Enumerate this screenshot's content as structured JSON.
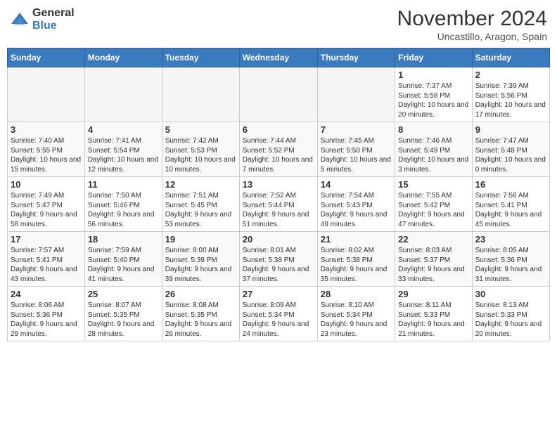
{
  "logo": {
    "general": "General",
    "blue": "Blue"
  },
  "header": {
    "month": "November 2024",
    "location": "Uncastillo, Aragon, Spain"
  },
  "weekdays": [
    "Sunday",
    "Monday",
    "Tuesday",
    "Wednesday",
    "Thursday",
    "Friday",
    "Saturday"
  ],
  "weeks": [
    [
      {
        "day": "",
        "info": ""
      },
      {
        "day": "",
        "info": ""
      },
      {
        "day": "",
        "info": ""
      },
      {
        "day": "",
        "info": ""
      },
      {
        "day": "",
        "info": ""
      },
      {
        "day": "1",
        "info": "Sunrise: 7:37 AM\nSunset: 5:58 PM\nDaylight: 10 hours and 20 minutes."
      },
      {
        "day": "2",
        "info": "Sunrise: 7:39 AM\nSunset: 5:56 PM\nDaylight: 10 hours and 17 minutes."
      }
    ],
    [
      {
        "day": "3",
        "info": "Sunrise: 7:40 AM\nSunset: 5:55 PM\nDaylight: 10 hours and 15 minutes."
      },
      {
        "day": "4",
        "info": "Sunrise: 7:41 AM\nSunset: 5:54 PM\nDaylight: 10 hours and 12 minutes."
      },
      {
        "day": "5",
        "info": "Sunrise: 7:42 AM\nSunset: 5:53 PM\nDaylight: 10 hours and 10 minutes."
      },
      {
        "day": "6",
        "info": "Sunrise: 7:44 AM\nSunset: 5:52 PM\nDaylight: 10 hours and 7 minutes."
      },
      {
        "day": "7",
        "info": "Sunrise: 7:45 AM\nSunset: 5:50 PM\nDaylight: 10 hours and 5 minutes."
      },
      {
        "day": "8",
        "info": "Sunrise: 7:46 AM\nSunset: 5:49 PM\nDaylight: 10 hours and 3 minutes."
      },
      {
        "day": "9",
        "info": "Sunrise: 7:47 AM\nSunset: 5:48 PM\nDaylight: 10 hours and 0 minutes."
      }
    ],
    [
      {
        "day": "10",
        "info": "Sunrise: 7:49 AM\nSunset: 5:47 PM\nDaylight: 9 hours and 58 minutes."
      },
      {
        "day": "11",
        "info": "Sunrise: 7:50 AM\nSunset: 5:46 PM\nDaylight: 9 hours and 56 minutes."
      },
      {
        "day": "12",
        "info": "Sunrise: 7:51 AM\nSunset: 5:45 PM\nDaylight: 9 hours and 53 minutes."
      },
      {
        "day": "13",
        "info": "Sunrise: 7:52 AM\nSunset: 5:44 PM\nDaylight: 9 hours and 51 minutes."
      },
      {
        "day": "14",
        "info": "Sunrise: 7:54 AM\nSunset: 5:43 PM\nDaylight: 9 hours and 49 minutes."
      },
      {
        "day": "15",
        "info": "Sunrise: 7:55 AM\nSunset: 5:42 PM\nDaylight: 9 hours and 47 minutes."
      },
      {
        "day": "16",
        "info": "Sunrise: 7:56 AM\nSunset: 5:41 PM\nDaylight: 9 hours and 45 minutes."
      }
    ],
    [
      {
        "day": "17",
        "info": "Sunrise: 7:57 AM\nSunset: 5:41 PM\nDaylight: 9 hours and 43 minutes."
      },
      {
        "day": "18",
        "info": "Sunrise: 7:59 AM\nSunset: 5:40 PM\nDaylight: 9 hours and 41 minutes."
      },
      {
        "day": "19",
        "info": "Sunrise: 8:00 AM\nSunset: 5:39 PM\nDaylight: 9 hours and 39 minutes."
      },
      {
        "day": "20",
        "info": "Sunrise: 8:01 AM\nSunset: 5:38 PM\nDaylight: 9 hours and 37 minutes."
      },
      {
        "day": "21",
        "info": "Sunrise: 8:02 AM\nSunset: 5:38 PM\nDaylight: 9 hours and 35 minutes."
      },
      {
        "day": "22",
        "info": "Sunrise: 8:03 AM\nSunset: 5:37 PM\nDaylight: 9 hours and 33 minutes."
      },
      {
        "day": "23",
        "info": "Sunrise: 8:05 AM\nSunset: 5:36 PM\nDaylight: 9 hours and 31 minutes."
      }
    ],
    [
      {
        "day": "24",
        "info": "Sunrise: 8:06 AM\nSunset: 5:36 PM\nDaylight: 9 hours and 29 minutes."
      },
      {
        "day": "25",
        "info": "Sunrise: 8:07 AM\nSunset: 5:35 PM\nDaylight: 9 hours and 28 minutes."
      },
      {
        "day": "26",
        "info": "Sunrise: 8:08 AM\nSunset: 5:35 PM\nDaylight: 9 hours and 26 minutes."
      },
      {
        "day": "27",
        "info": "Sunrise: 8:09 AM\nSunset: 5:34 PM\nDaylight: 9 hours and 24 minutes."
      },
      {
        "day": "28",
        "info": "Sunrise: 8:10 AM\nSunset: 5:34 PM\nDaylight: 9 hours and 23 minutes."
      },
      {
        "day": "29",
        "info": "Sunrise: 8:11 AM\nSunset: 5:33 PM\nDaylight: 9 hours and 21 minutes."
      },
      {
        "day": "30",
        "info": "Sunrise: 8:13 AM\nSunset: 5:33 PM\nDaylight: 9 hours and 20 minutes."
      }
    ]
  ]
}
